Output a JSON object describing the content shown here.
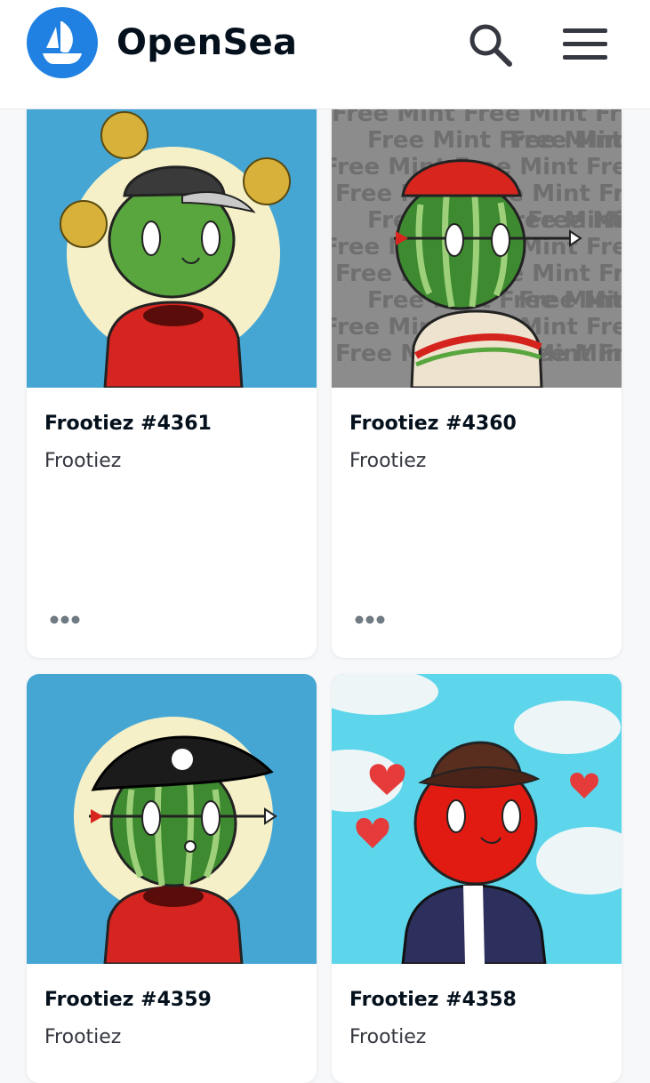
{
  "header": {
    "brand": "OpenSea",
    "logo_icon": "opensea-ship-logo",
    "search_icon": "search-icon",
    "menu_icon": "hamburger-menu-icon"
  },
  "colors": {
    "brand_blue": "#2081e2",
    "text_dark": "#04111d",
    "text_muted": "#353840"
  },
  "cards": [
    {
      "title": "Frootiez #4361",
      "collection": "Frootiez",
      "more_icon": "more-options-icon"
    },
    {
      "title": "Frootiez #4360",
      "collection": "Frootiez",
      "more_icon": "more-options-icon",
      "watermark": "Free Mint"
    },
    {
      "title": "Frootiez #4359",
      "collection": "Frootiez"
    },
    {
      "title": "Frootiez #4358",
      "collection": "Frootiez"
    }
  ]
}
